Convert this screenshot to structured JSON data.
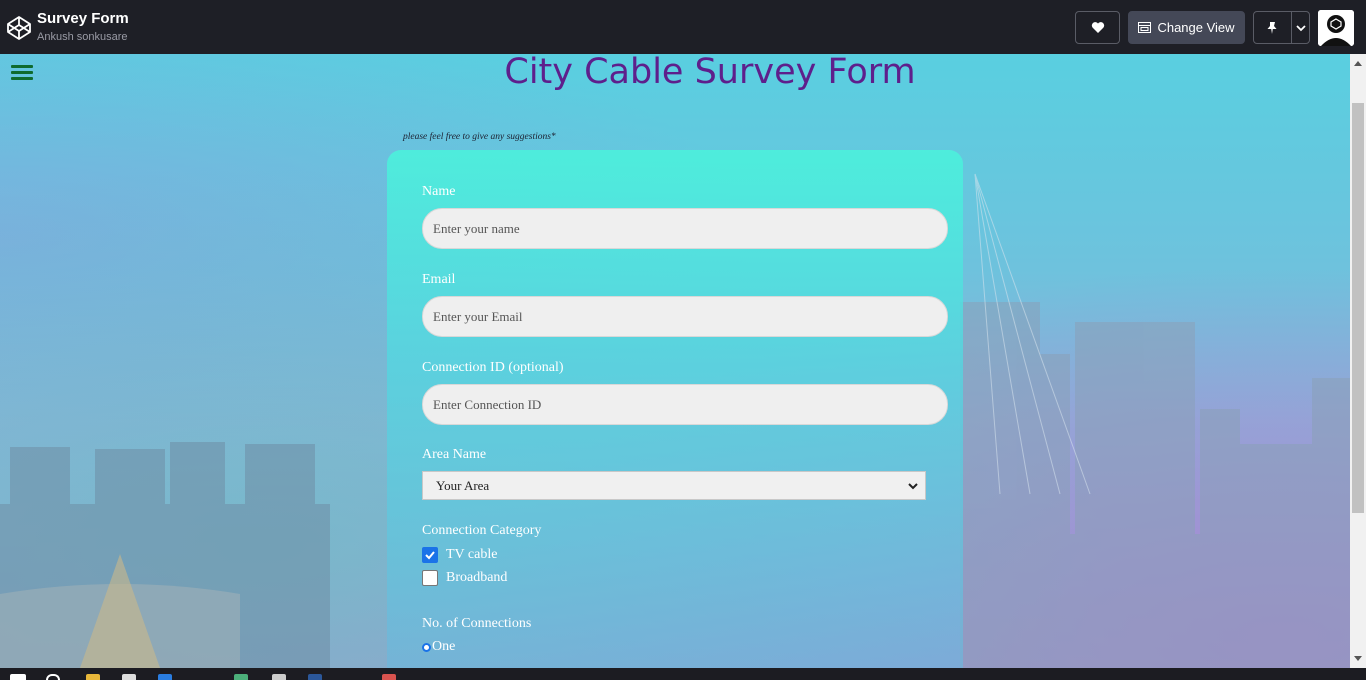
{
  "app": {
    "title": "Survey Form",
    "author": "Ankush sonkusare",
    "heart_icon": "heart-icon",
    "change_view_label": "Change View",
    "pin_icon": "pin-icon"
  },
  "form": {
    "title": "City Cable Survey Form",
    "note": "please feel free to give any suggestions*",
    "name_label": "Name",
    "name_placeholder": "Enter your name",
    "email_label": "Email",
    "email_placeholder": "Enter your Email",
    "conn_label": "Connection ID (optional)",
    "conn_placeholder": "Enter Connection ID",
    "area_label": "Area Name",
    "area_value": "Your Area",
    "category_label": "Connection Category",
    "categories": [
      {
        "label": "TV cable",
        "checked": true
      },
      {
        "label": "Broadband",
        "checked": false
      }
    ],
    "count_label": "No. of Connections",
    "count_options": [
      {
        "label": "One",
        "selected": true
      }
    ]
  },
  "colors": {
    "title": "#5e1f8c",
    "accent": "#1a73e8",
    "topbar": "#1e1f26"
  }
}
